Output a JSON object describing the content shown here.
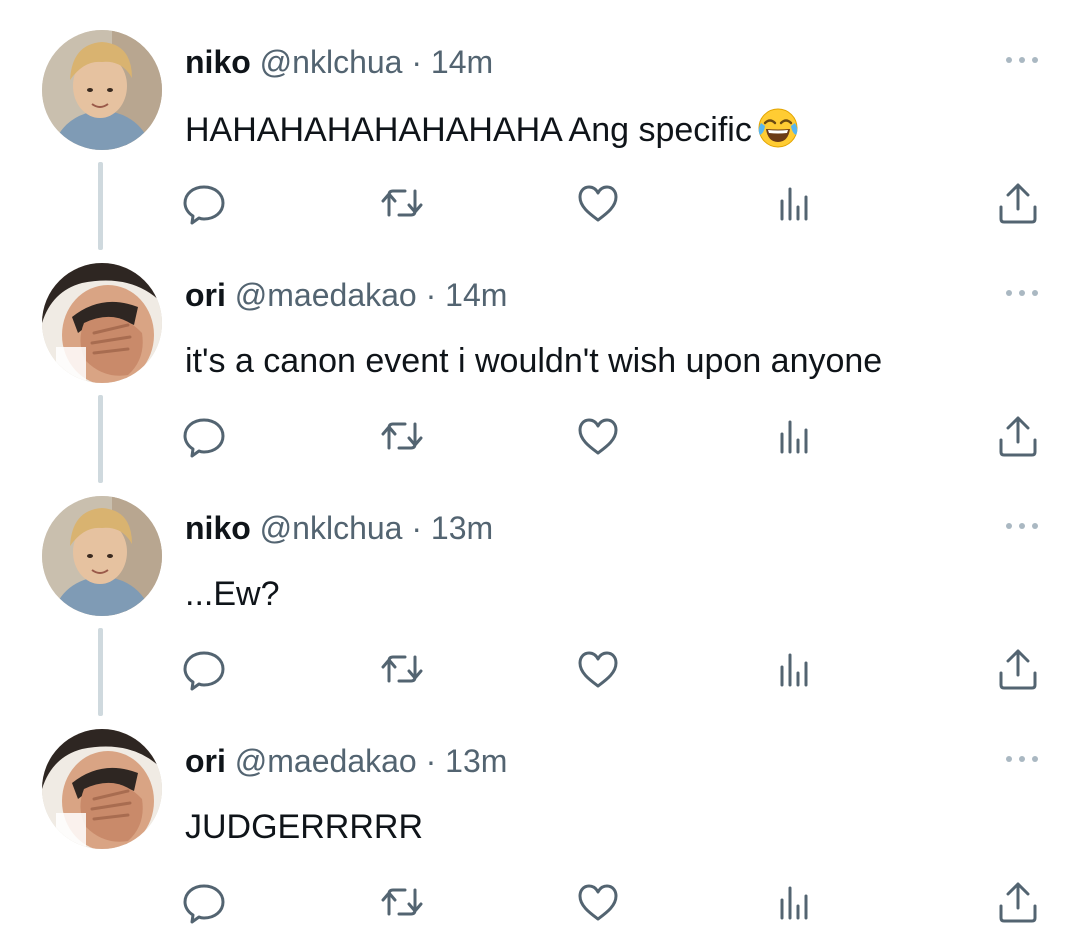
{
  "tweets": [
    {
      "name": "niko",
      "handle": "@nklchua",
      "separator": "·",
      "time": "14m",
      "text": "HAHAHAHAHAHAHAHA Ang specific",
      "emoji": "face-with-tears-of-joy",
      "avatar": "niko-avatar",
      "thread_line": true
    },
    {
      "name": "ori",
      "handle": "@maedakao",
      "separator": "·",
      "time": "14m",
      "text": "it's a canon event i wouldn't wish upon anyone",
      "avatar": "ori-avatar",
      "thread_line": true
    },
    {
      "name": "niko",
      "handle": "@nklchua",
      "separator": "·",
      "time": "13m",
      "text": "...Ew?",
      "avatar": "niko-avatar",
      "thread_line": true
    },
    {
      "name": "ori",
      "handle": "@maedakao",
      "separator": "·",
      "time": "13m",
      "text": "JUDGERRRRR",
      "avatar": "ori-avatar",
      "thread_line": false
    }
  ],
  "action_icons": [
    "reply-icon",
    "retweet-icon",
    "like-icon",
    "views-icon",
    "share-icon"
  ],
  "colors": {
    "text": "#0f1419",
    "secondary": "#536471",
    "icon": "#536471",
    "thread_line": "#cfd9de",
    "more_dots": "#aab8c2"
  }
}
